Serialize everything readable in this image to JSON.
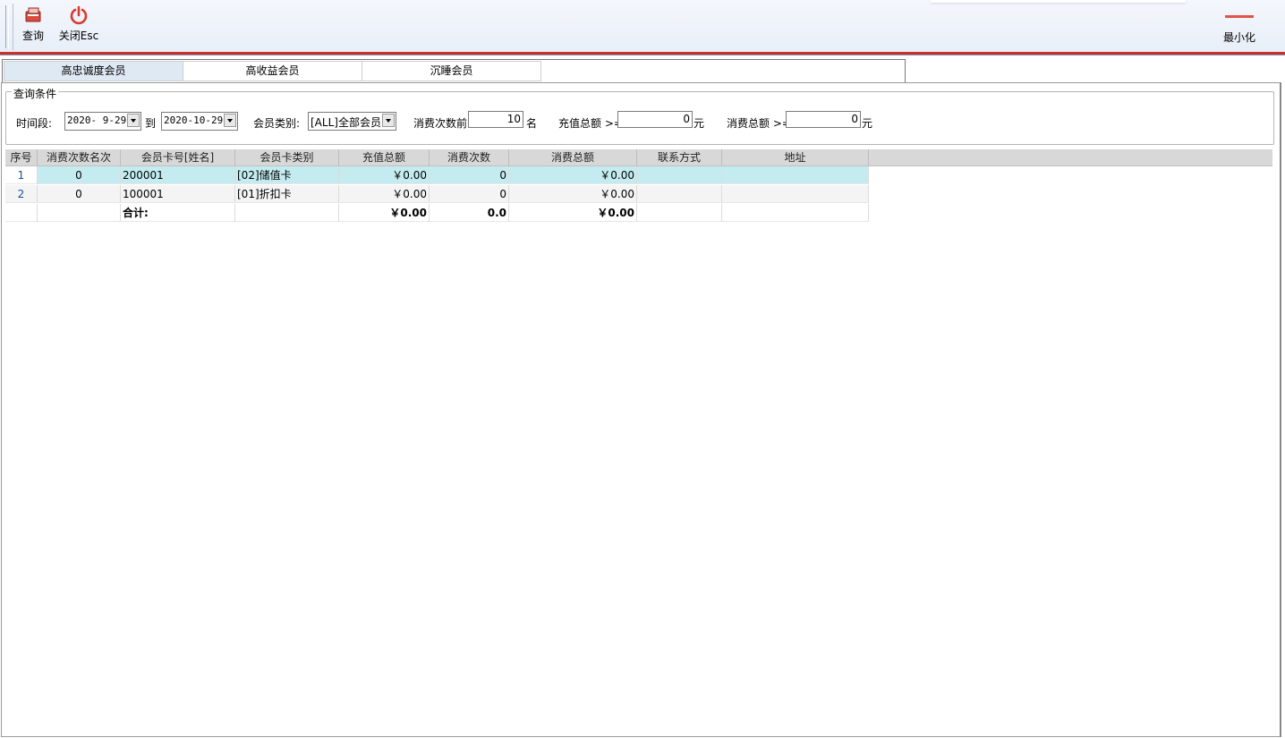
{
  "toolbar": {
    "query_label": "查询",
    "close_label": "关闭Esc",
    "minimize_label": "最小化",
    "accent_color": "#c8322a"
  },
  "tabs": [
    {
      "label": "高忠诚度会员",
      "active": true
    },
    {
      "label": "高收益会员",
      "active": false
    },
    {
      "label": "沉睡会员",
      "active": false
    }
  ],
  "filters": {
    "group_title": "查询条件",
    "period_label": "时间段:",
    "date_from": "2020- 9-29",
    "to_label": "到",
    "date_to": "2020-10-29",
    "member_type_label": "会员类别:",
    "member_type_value": "[ALL]全部会员",
    "consume_top_label": "消费次数前",
    "consume_top_value": "10",
    "consume_top_unit": "名",
    "recharge_label": "充值总额 >=",
    "recharge_value": "0",
    "recharge_unit": "元",
    "spend_label": "消费总额 >=",
    "spend_value": "0",
    "spend_unit": "元"
  },
  "table": {
    "headers": [
      "序号",
      "消费次数名次",
      "会员卡号[姓名]",
      "会员卡类别",
      "充值总额",
      "消费次数",
      "消费总额",
      "联系方式",
      "地址"
    ],
    "rows": [
      {
        "index": "1",
        "rank": "0",
        "card": "200001",
        "card_type": "[02]储值卡",
        "recharge": "￥0.00",
        "count": "0",
        "spend": "￥0.00",
        "contact": "",
        "address": ""
      },
      {
        "index": "2",
        "rank": "0",
        "card": "100001",
        "card_type": "[01]折扣卡",
        "recharge": "￥0.00",
        "count": "0",
        "spend": "￥0.00",
        "contact": "",
        "address": ""
      }
    ],
    "total": {
      "label": "合计:",
      "recharge": "￥0.00",
      "count": "0.0",
      "spend": "￥0.00"
    }
  }
}
